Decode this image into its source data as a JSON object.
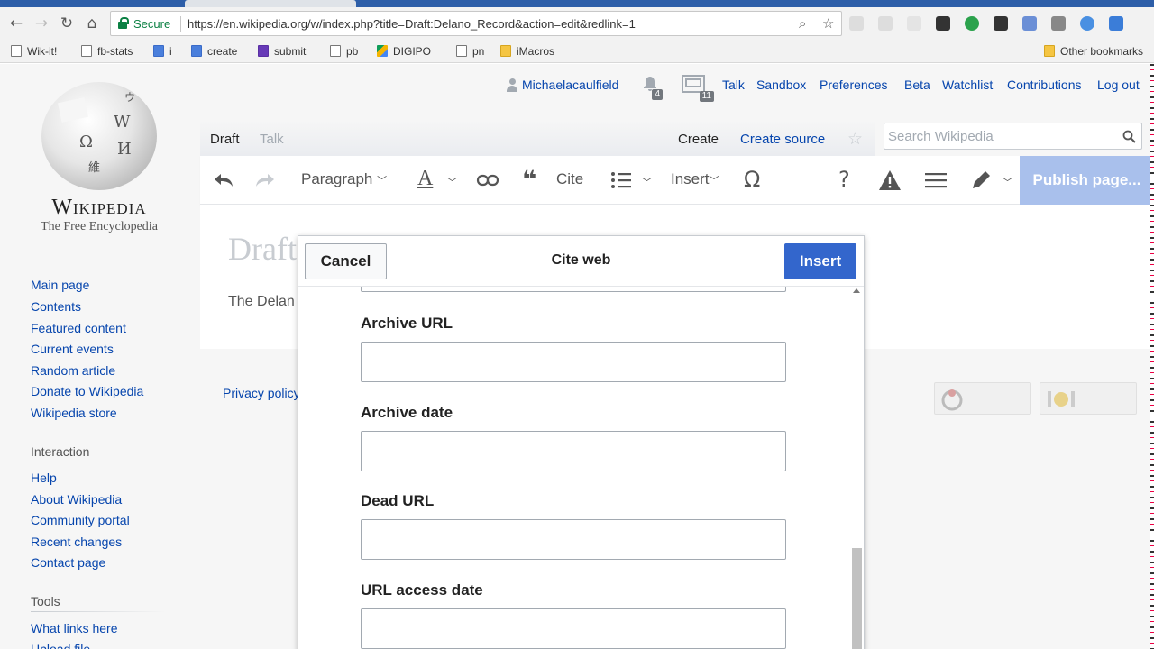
{
  "browser": {
    "secure_label": "Secure",
    "url": "https://en.wikipedia.org/w/index.php?title=Draft:Delano_Record&action=edit&redlink=1",
    "bookmarks": [
      "Wik-it!",
      "fb-stats",
      "i",
      "create",
      "submit",
      "pb",
      "DIGIPO",
      "pn",
      "iMacros"
    ],
    "other_bookmarks": "Other bookmarks"
  },
  "logo": {
    "wordmark": "Wikipedia",
    "tagline": "The Free Encyclopedia"
  },
  "personal": {
    "username": "Michaelacaulfield",
    "alerts_count": "4",
    "notices_count": "11",
    "links": [
      "Talk",
      "Sandbox",
      "Preferences",
      "Beta",
      "Watchlist",
      "Contributions",
      "Log out"
    ]
  },
  "page_tabs": {
    "left": [
      "Draft",
      "Talk"
    ],
    "right": [
      "Create",
      "Create source"
    ]
  },
  "search": {
    "placeholder": "Search Wikipedia"
  },
  "editor_toolbar": {
    "paragraph": "Paragraph",
    "cite": "Cite",
    "insert": "Insert",
    "publish": "Publish page..."
  },
  "content": {
    "title": "Draft",
    "text": "The Delan"
  },
  "sidebar": {
    "nav": [
      "Main page",
      "Contents",
      "Featured content",
      "Current events",
      "Random article",
      "Donate to Wikipedia",
      "Wikipedia store"
    ],
    "interaction_heading": "Interaction",
    "interaction": [
      "Help",
      "About Wikipedia",
      "Community portal",
      "Recent changes",
      "Contact page"
    ],
    "tools_heading": "Tools",
    "tools": [
      "What links here",
      "Upload file"
    ]
  },
  "footer": {
    "privacy": "Privacy policy"
  },
  "dialog": {
    "title": "Cite web",
    "cancel": "Cancel",
    "insert": "Insert",
    "fields": [
      {
        "label": "Archive URL",
        "value": ""
      },
      {
        "label": "Archive date",
        "value": ""
      },
      {
        "label": "Dead URL",
        "value": ""
      },
      {
        "label": "URL access date",
        "value": ""
      }
    ]
  },
  "colors": {
    "link": "#0645ad",
    "progressive": "#3366cc",
    "publish_disabled": "#a9c0ec",
    "chrome_secure": "#0b8043"
  }
}
